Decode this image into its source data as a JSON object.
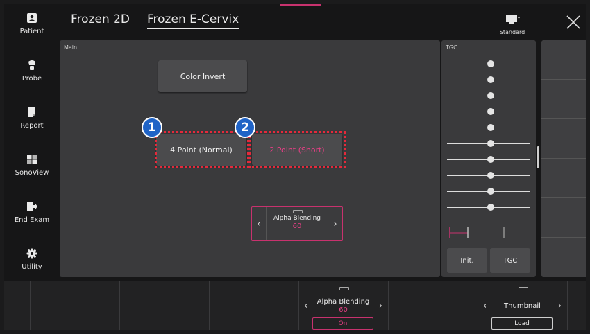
{
  "sidebar": {
    "items": [
      {
        "label": "Patient",
        "icon": "patient-icon"
      },
      {
        "label": "Probe",
        "icon": "probe-icon"
      },
      {
        "label": "Report",
        "icon": "report-icon"
      },
      {
        "label": "SonoView",
        "icon": "sonoview-icon"
      },
      {
        "label": "End Exam",
        "icon": "end-exam-icon"
      },
      {
        "label": "Utility",
        "icon": "gear-icon"
      }
    ]
  },
  "header": {
    "tabs": [
      {
        "label": "Frozen 2D",
        "active": false
      },
      {
        "label": "Frozen E-Cervix",
        "active": true
      }
    ],
    "preset_label": "Standard",
    "close_icon": "close-icon"
  },
  "main": {
    "title": "Main",
    "color_invert_label": "Color Invert",
    "point_normal_label": "4 Point (Normal)",
    "point_short_label": "2 Point (Short)",
    "badges": [
      "1",
      "2"
    ],
    "alpha_blending": {
      "label": "Alpha Blending",
      "value": "60"
    }
  },
  "tgc": {
    "title": "TGC",
    "slider_count": 10,
    "init_label": "Init.",
    "tgc_label": "TGC"
  },
  "bottom": {
    "alpha_blending": {
      "label": "Alpha Blending",
      "value": "60",
      "pill": "On"
    },
    "thumbnail": {
      "label": "Thumbnail",
      "pill": "Load"
    }
  },
  "colors": {
    "accent": "#e83f86",
    "callout": "#e5293b",
    "badge": "#1f63c6",
    "panel": "#3a3a3c"
  }
}
